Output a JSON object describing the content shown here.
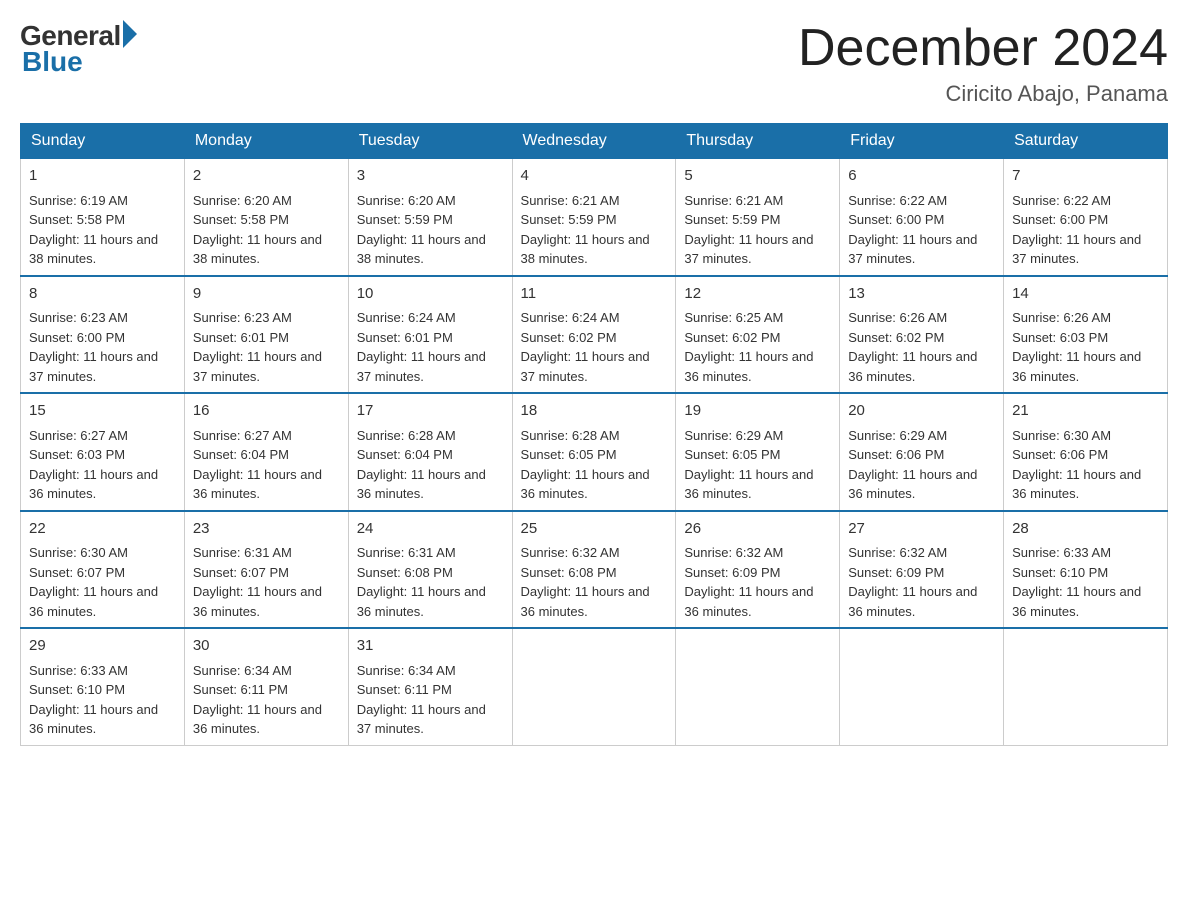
{
  "header": {
    "logo_general": "General",
    "logo_blue": "Blue",
    "month_title": "December 2024",
    "location": "Ciricito Abajo, Panama"
  },
  "days_of_week": [
    "Sunday",
    "Monday",
    "Tuesday",
    "Wednesday",
    "Thursday",
    "Friday",
    "Saturday"
  ],
  "weeks": [
    [
      {
        "day": "1",
        "sunrise": "6:19 AM",
        "sunset": "5:58 PM",
        "daylight": "11 hours and 38 minutes."
      },
      {
        "day": "2",
        "sunrise": "6:20 AM",
        "sunset": "5:58 PM",
        "daylight": "11 hours and 38 minutes."
      },
      {
        "day": "3",
        "sunrise": "6:20 AM",
        "sunset": "5:59 PM",
        "daylight": "11 hours and 38 minutes."
      },
      {
        "day": "4",
        "sunrise": "6:21 AM",
        "sunset": "5:59 PM",
        "daylight": "11 hours and 38 minutes."
      },
      {
        "day": "5",
        "sunrise": "6:21 AM",
        "sunset": "5:59 PM",
        "daylight": "11 hours and 37 minutes."
      },
      {
        "day": "6",
        "sunrise": "6:22 AM",
        "sunset": "6:00 PM",
        "daylight": "11 hours and 37 minutes."
      },
      {
        "day": "7",
        "sunrise": "6:22 AM",
        "sunset": "6:00 PM",
        "daylight": "11 hours and 37 minutes."
      }
    ],
    [
      {
        "day": "8",
        "sunrise": "6:23 AM",
        "sunset": "6:00 PM",
        "daylight": "11 hours and 37 minutes."
      },
      {
        "day": "9",
        "sunrise": "6:23 AM",
        "sunset": "6:01 PM",
        "daylight": "11 hours and 37 minutes."
      },
      {
        "day": "10",
        "sunrise": "6:24 AM",
        "sunset": "6:01 PM",
        "daylight": "11 hours and 37 minutes."
      },
      {
        "day": "11",
        "sunrise": "6:24 AM",
        "sunset": "6:02 PM",
        "daylight": "11 hours and 37 minutes."
      },
      {
        "day": "12",
        "sunrise": "6:25 AM",
        "sunset": "6:02 PM",
        "daylight": "11 hours and 36 minutes."
      },
      {
        "day": "13",
        "sunrise": "6:26 AM",
        "sunset": "6:02 PM",
        "daylight": "11 hours and 36 minutes."
      },
      {
        "day": "14",
        "sunrise": "6:26 AM",
        "sunset": "6:03 PM",
        "daylight": "11 hours and 36 minutes."
      }
    ],
    [
      {
        "day": "15",
        "sunrise": "6:27 AM",
        "sunset": "6:03 PM",
        "daylight": "11 hours and 36 minutes."
      },
      {
        "day": "16",
        "sunrise": "6:27 AM",
        "sunset": "6:04 PM",
        "daylight": "11 hours and 36 minutes."
      },
      {
        "day": "17",
        "sunrise": "6:28 AM",
        "sunset": "6:04 PM",
        "daylight": "11 hours and 36 minutes."
      },
      {
        "day": "18",
        "sunrise": "6:28 AM",
        "sunset": "6:05 PM",
        "daylight": "11 hours and 36 minutes."
      },
      {
        "day": "19",
        "sunrise": "6:29 AM",
        "sunset": "6:05 PM",
        "daylight": "11 hours and 36 minutes."
      },
      {
        "day": "20",
        "sunrise": "6:29 AM",
        "sunset": "6:06 PM",
        "daylight": "11 hours and 36 minutes."
      },
      {
        "day": "21",
        "sunrise": "6:30 AM",
        "sunset": "6:06 PM",
        "daylight": "11 hours and 36 minutes."
      }
    ],
    [
      {
        "day": "22",
        "sunrise": "6:30 AM",
        "sunset": "6:07 PM",
        "daylight": "11 hours and 36 minutes."
      },
      {
        "day": "23",
        "sunrise": "6:31 AM",
        "sunset": "6:07 PM",
        "daylight": "11 hours and 36 minutes."
      },
      {
        "day": "24",
        "sunrise": "6:31 AM",
        "sunset": "6:08 PM",
        "daylight": "11 hours and 36 minutes."
      },
      {
        "day": "25",
        "sunrise": "6:32 AM",
        "sunset": "6:08 PM",
        "daylight": "11 hours and 36 minutes."
      },
      {
        "day": "26",
        "sunrise": "6:32 AM",
        "sunset": "6:09 PM",
        "daylight": "11 hours and 36 minutes."
      },
      {
        "day": "27",
        "sunrise": "6:32 AM",
        "sunset": "6:09 PM",
        "daylight": "11 hours and 36 minutes."
      },
      {
        "day": "28",
        "sunrise": "6:33 AM",
        "sunset": "6:10 PM",
        "daylight": "11 hours and 36 minutes."
      }
    ],
    [
      {
        "day": "29",
        "sunrise": "6:33 AM",
        "sunset": "6:10 PM",
        "daylight": "11 hours and 36 minutes."
      },
      {
        "day": "30",
        "sunrise": "6:34 AM",
        "sunset": "6:11 PM",
        "daylight": "11 hours and 36 minutes."
      },
      {
        "day": "31",
        "sunrise": "6:34 AM",
        "sunset": "6:11 PM",
        "daylight": "11 hours and 37 minutes."
      },
      null,
      null,
      null,
      null
    ]
  ]
}
